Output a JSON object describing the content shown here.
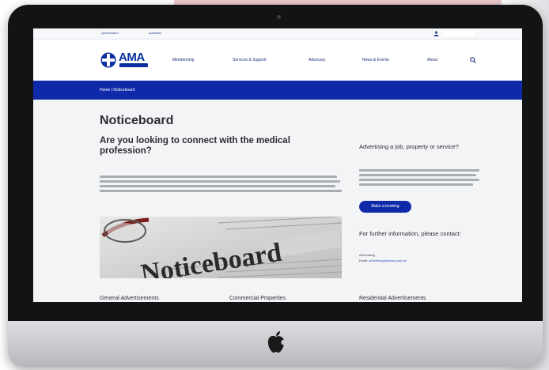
{
  "topbar": {
    "links": [
      "Queensland",
      "Australia"
    ]
  },
  "header": {
    "logo_text": "AMA",
    "nav": [
      "Membership",
      "Services & Support",
      "Advocacy",
      "News & Events",
      "About"
    ]
  },
  "breadcrumb": "Home | Noticeboard",
  "main": {
    "page_title": "Noticeboard",
    "lead_title": "Are you looking to connect with the medical profession?",
    "hero_text": "Noticeboard",
    "sections": [
      "General Advertisements",
      "Commercial Properties",
      "Residential Advertisements"
    ]
  },
  "sidebar": {
    "advert_title": "Advertising a job, property or service?",
    "listing_button": "Make a booking",
    "contact_title": "For further information, please contact:",
    "contact_name": "Advertising",
    "contact_email_label": "Email:",
    "contact_email": "advertising@amaq.com.au"
  },
  "colors": {
    "brand_blue": "#0f2aa8",
    "logo_blue": "#0a2ea0"
  }
}
